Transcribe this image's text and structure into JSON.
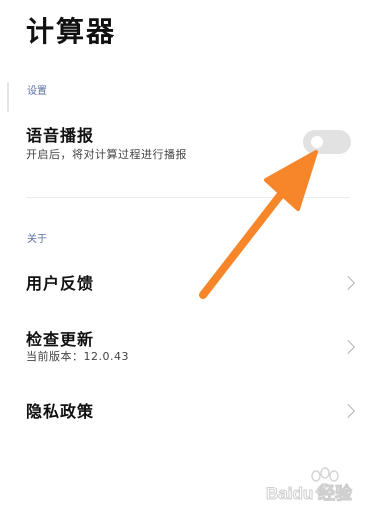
{
  "app": {
    "title": "计算器"
  },
  "sections": {
    "settings": {
      "label": "设置",
      "voice": {
        "title": "语音播报",
        "subtitle": "开启后，将对计算过程进行播报",
        "enabled": false
      }
    },
    "about": {
      "label": "关于",
      "items": [
        {
          "title": "用户反馈"
        },
        {
          "title": "检查更新",
          "subtitle": "当前版本：12.0.43"
        },
        {
          "title": "隐私政策"
        }
      ]
    }
  },
  "colors": {
    "section_label": "#5b6fa6",
    "toggle_off": "#e2e2e2",
    "annotation_arrow": "#f7852a"
  },
  "watermark": {
    "text": "Baidu 经验"
  }
}
